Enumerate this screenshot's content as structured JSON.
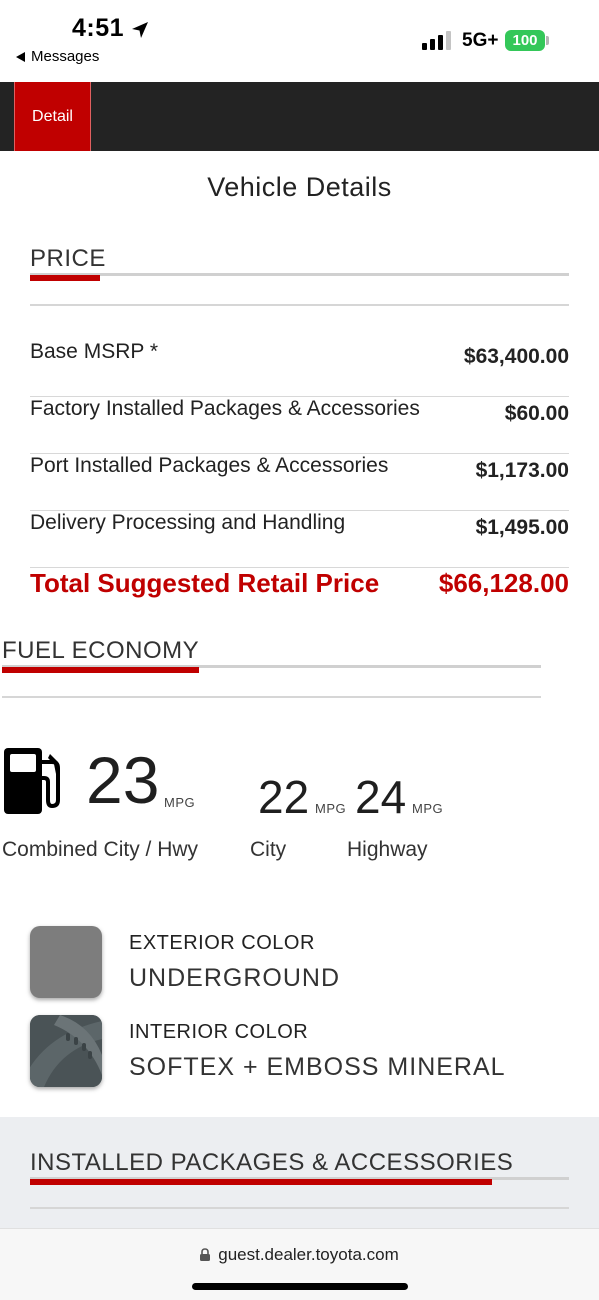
{
  "status_bar": {
    "time": "4:51",
    "back_label": "Messages",
    "network": "5G+",
    "battery": "100"
  },
  "nav": {
    "tab_label": "Detail"
  },
  "page": {
    "title": "Vehicle Details"
  },
  "price": {
    "header": "PRICE",
    "rows": [
      {
        "label": "Base MSRP *",
        "value": "$63,400.00"
      },
      {
        "label": "Factory Installed Packages & Accessories",
        "value": "$60.00"
      },
      {
        "label": "Port Installed Packages & Accessories",
        "value": "$1,173.00"
      },
      {
        "label": "Delivery Processing and Handling",
        "value": "$1,495.00"
      }
    ],
    "total_label": "Total Suggested Retail Price",
    "total_value": "$66,128.00"
  },
  "fuel": {
    "header": "FUEL ECONOMY",
    "combined": "23",
    "city": "22",
    "highway": "24",
    "unit": "MPG",
    "combined_caption": "Combined City / Hwy",
    "city_caption": "City",
    "highway_caption": "Highway"
  },
  "colors": {
    "exterior_title": "EXTERIOR COLOR",
    "exterior_value": "UNDERGROUND",
    "exterior_hex": "#7d7d7d",
    "interior_title": "INTERIOR COLOR",
    "interior_value": "SOFTEX + EMBOSS MINERAL",
    "interior_hex": "#4a5356"
  },
  "packages": {
    "header": "INSTALLED PACKAGES & ACCESSORIES"
  },
  "browser": {
    "url": "guest.dealer.toyota.com"
  },
  "theme": {
    "accent": "#c00000",
    "nav_bg": "#232323",
    "battery_green": "#34c759"
  }
}
